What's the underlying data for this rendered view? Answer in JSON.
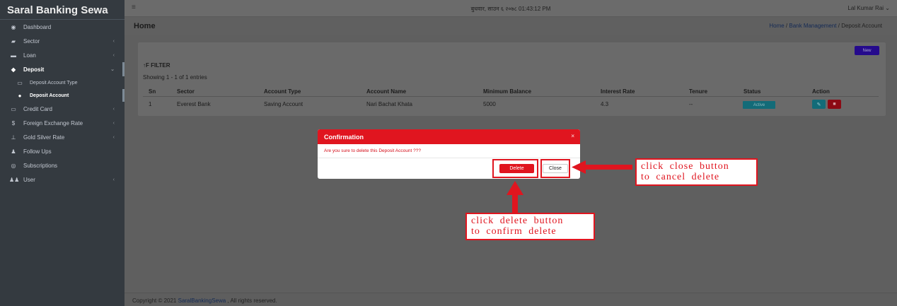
{
  "brand": "Saral Banking Sewa",
  "sidebar": {
    "items": [
      {
        "label": "Dashboard",
        "icon": "dashboard-icon",
        "glyph": "◉"
      },
      {
        "label": "Sector",
        "icon": "sector-icon",
        "glyph": "▰",
        "chevron": "‹"
      },
      {
        "label": "Loan",
        "icon": "loan-icon",
        "glyph": "▬",
        "chevron": "‹"
      },
      {
        "label": "Deposit",
        "icon": "deposit-icon",
        "glyph": "◆",
        "chevron": "⌄"
      },
      {
        "label": "Deposit Account Type",
        "icon": "account-type-icon",
        "glyph": "▭"
      },
      {
        "label": "Deposit Account",
        "icon": "account-icon",
        "glyph": "●"
      },
      {
        "label": "Credit Card",
        "icon": "credit-card-icon",
        "glyph": "▭",
        "chevron": "‹"
      },
      {
        "label": "Foreign Exchange Rate",
        "icon": "dollar-icon",
        "glyph": "$",
        "chevron": "‹"
      },
      {
        "label": "Gold Silver Rate",
        "icon": "gold-icon",
        "glyph": "⊥",
        "chevron": "‹"
      },
      {
        "label": "Follow Ups",
        "icon": "follow-ups-icon",
        "glyph": "♟"
      },
      {
        "label": "Subscriptions",
        "icon": "subscriptions-icon",
        "glyph": "◎"
      },
      {
        "label": "User",
        "icon": "users-icon",
        "glyph": "♟♟",
        "chevron": "‹"
      }
    ]
  },
  "topbar": {
    "menu_glyph": "≡",
    "datetime": "बुधवार, साउन ६ २०७८ 01:43:12 PM",
    "user": "Lal Kumar Rai",
    "user_caret": " ⌄"
  },
  "header": {
    "title": "Home",
    "breadcrumb": {
      "home": "Home",
      "sep": " / ",
      "section": "Bank Management",
      "current": "Deposit Account"
    }
  },
  "card": {
    "new_label": "New",
    "filter_label": "↑F FILTER",
    "showing": "Showing 1 - 1 of 1 entries",
    "columns": [
      "Sn",
      "Sector",
      "Account Type",
      "Account Name",
      "Minimum Balance",
      "Interest Rate",
      "Tenure",
      "Status",
      "Action"
    ],
    "rows": [
      {
        "sn": "1",
        "sector": "Everest Bank",
        "account_type": "Saving Account",
        "account_name": "Nari Bachat Khata",
        "minimum_balance": "5000",
        "interest_rate": "4.3",
        "tenure": "--",
        "status": "Active"
      }
    ],
    "edit_glyph": "✎",
    "delete_glyph": "■"
  },
  "modal": {
    "title": "Confirmation",
    "close_x": "×",
    "message": "Are you sure to delete this Deposit Account ???",
    "delete_label": "Delete",
    "close_label": "Close"
  },
  "annotations": {
    "close_note": [
      "click close button",
      "to cancel delete"
    ],
    "delete_note": [
      "click delete button",
      "to confirm delete"
    ]
  },
  "footer": {
    "prefix": "Copyright © 2021 ",
    "link": "SaralBankingSewa",
    "suffix": " , All rights reserved."
  },
  "colors": {
    "accent_red": "#e0151f",
    "new_button": "#250a8c",
    "status_teal": "#136b78"
  }
}
